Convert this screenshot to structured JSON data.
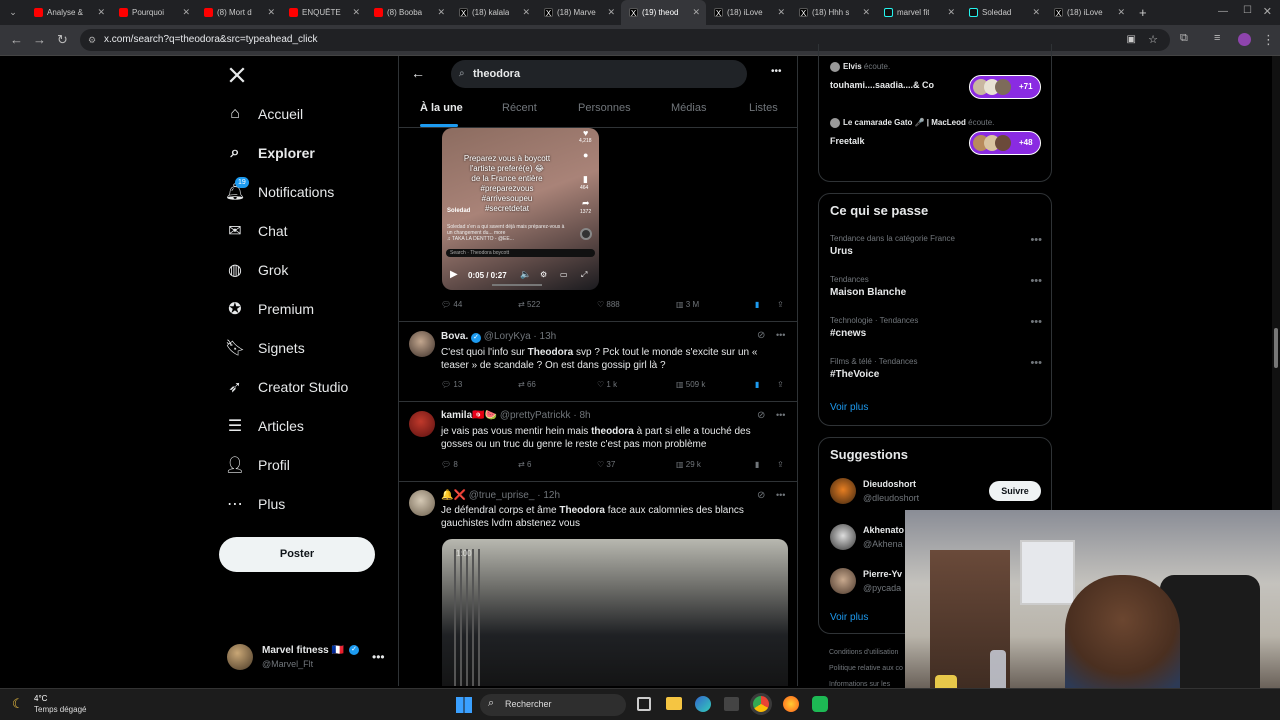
{
  "browser": {
    "tabs": [
      {
        "title": "Analyse &",
        "favicon": "youtube-icon"
      },
      {
        "title": "Pourquoi",
        "favicon": "youtube-icon"
      },
      {
        "title": "(8) Mort d",
        "favicon": "youtube-icon"
      },
      {
        "title": "ENQUÊTE",
        "favicon": "youtube-icon"
      },
      {
        "title": "(8) Booba",
        "favicon": "youtube-icon"
      },
      {
        "title": "(18) kalala",
        "favicon": "x-icon"
      },
      {
        "title": "(18) Marve",
        "favicon": "x-icon"
      },
      {
        "title": "(19) theod",
        "favicon": "x-icon",
        "active": true
      },
      {
        "title": "(18) iLove",
        "favicon": "x-icon"
      },
      {
        "title": "(18) Hhh s",
        "favicon": "x-icon"
      },
      {
        "title": "marvel fit",
        "favicon": "tiktok-icon"
      },
      {
        "title": "Soledad",
        "favicon": "tiktok-icon"
      },
      {
        "title": "(18) iLove",
        "favicon": "x-icon"
      }
    ],
    "url": "x.com/search?q=theodora&src=typeahead_click"
  },
  "sidebar": {
    "items": [
      {
        "label": "Accueil",
        "icon": "home-icon"
      },
      {
        "label": "Explorer",
        "icon": "search-icon",
        "bold": true
      },
      {
        "label": "Notifications",
        "icon": "bell-icon",
        "badge": "19"
      },
      {
        "label": "Chat",
        "icon": "mail-icon"
      },
      {
        "label": "Grok",
        "icon": "grok-icon"
      },
      {
        "label": "Premium",
        "icon": "premium-icon"
      },
      {
        "label": "Signets",
        "icon": "bookmark-icon"
      },
      {
        "label": "Creator Studio",
        "icon": "rocket-icon"
      },
      {
        "label": "Articles",
        "icon": "article-icon"
      },
      {
        "label": "Profil",
        "icon": "person-icon"
      },
      {
        "label": "Plus",
        "icon": "more-circle-icon"
      }
    ],
    "post_label": "Poster",
    "account": {
      "name": "Marvel fitness 🇫🇷",
      "handle": "@Marvel_Flt"
    }
  },
  "search": {
    "query": "theodora",
    "tabs": [
      "À la une",
      "Récent",
      "Personnes",
      "Médias",
      "Listes"
    ]
  },
  "video": {
    "overlay_lines": [
      "Preparez vous à boycott",
      "l'artiste preferé(e) 😂",
      "de la France entière",
      "#preparezvous",
      "#arrivesoupeu",
      "#secretdetat"
    ],
    "username": "Soledad",
    "time": "0:05 / 0:27",
    "side_counts": [
      "4,218",
      "464",
      "1372"
    ],
    "search_label": "Search · Theodora boycott",
    "caption": "Soledad s'en a qui savent déjà mais préparez-vous à un changement du... more",
    "music": "♫ TAKA LA DENTTO - @EE..."
  },
  "tweets": [
    {
      "actions": {
        "replies": "44",
        "reposts": "522",
        "likes": "888",
        "views": "3 M"
      }
    },
    {
      "name": "Bova.",
      "handle": "@LoryKya",
      "time": "· 13h",
      "text_pre": "C'est quoi l'info sur ",
      "text_bold": "Theodora",
      "text_post": " svp ? Pck tout le monde s'excite sur un « teaser » de scandale ? On est dans gossip girl là ?",
      "actions": {
        "replies": "13",
        "reposts": "66",
        "likes": "1 k",
        "views": "509 k"
      }
    },
    {
      "name": "kamila🇹🇳🍉",
      "handle": "@prettyPatrickk",
      "time": "· 8h",
      "text_pre": "je vais pas vous mentir hein mais ",
      "text_bold": "theodora",
      "text_post": " à part si elle a touché des gosses ou un truc du genre le reste c'est pas mon problème",
      "actions": {
        "replies": "8",
        "reposts": "6",
        "likes": "37",
        "views": "29 k"
      }
    },
    {
      "name": "🔔❌",
      "handle": "@true_uprise_",
      "time": "· 12h",
      "text_pre": "Je défendral corps et âme ",
      "text_bold": "Theodora",
      "text_post": " face aux calomnies des blancs gauchistes lvdm abstenez vous",
      "video_time": "1:00"
    }
  ],
  "spaces": [
    {
      "host": "Elvis",
      "suffix": "écoute.",
      "title": "touhami....saadia....& Co",
      "count": "+71"
    },
    {
      "host": "Le camarade Gato 🎤 | MacLeod",
      "suffix": "écoute.",
      "title": "Freetalk",
      "count": "+48"
    }
  ],
  "trends": {
    "heading": "Ce qui se passe",
    "items": [
      {
        "context": "Tendance dans la catégorie France",
        "name": "Urus"
      },
      {
        "context": "Tendances",
        "name": "Maison Blanche"
      },
      {
        "context": "Technologie · Tendances",
        "name": "#cnews"
      },
      {
        "context": "Films & télé · Tendances",
        "name": "#TheVoice"
      }
    ],
    "more": "Voir plus"
  },
  "suggestions": {
    "heading": "Suggestions",
    "items": [
      {
        "name": "Dieudoshort",
        "handle": "@dleudoshort",
        "follow": "Suivre"
      },
      {
        "name": "Akhenato",
        "handle": "@Akhena"
      },
      {
        "name": "Pierre-Yv",
        "handle": "@pycada"
      }
    ],
    "more": "Voir plus"
  },
  "footer_links": [
    "Conditions d'utilisation",
    "Politique relative aux co",
    "Informations sur les"
  ],
  "taskbar": {
    "temp": "4°C",
    "weather": "Temps dégagé",
    "search_label": "Rechercher"
  }
}
